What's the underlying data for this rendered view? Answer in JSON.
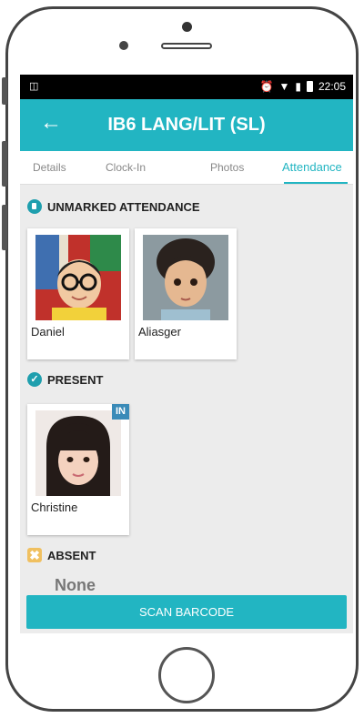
{
  "status_bar": {
    "left_icon": "lock-screen-icon",
    "time": "22:05",
    "icons": [
      "alarm-icon",
      "wifi-icon",
      "signal-icon",
      "battery-icon"
    ]
  },
  "appbar": {
    "back_icon": "arrow-left-icon",
    "title": "IB6 LANG/LIT (SL)"
  },
  "tabs": [
    {
      "label": "Details",
      "active": false
    },
    {
      "label": "Clock-In",
      "active": false
    },
    {
      "label": "Photos",
      "active": false
    },
    {
      "label": "Attendance",
      "active": true
    }
  ],
  "sections": {
    "unmarked": {
      "title": "UNMARKED ATTENDANCE",
      "icon": "unmarked-icon",
      "students": [
        {
          "name": "Daniel"
        },
        {
          "name": "Aliasger"
        }
      ]
    },
    "present": {
      "title": "PRESENT",
      "icon": "check-circle-icon",
      "students": [
        {
          "name": "Christine",
          "badge": "IN"
        }
      ]
    },
    "absent": {
      "title": "ABSENT",
      "icon": "absent-x-icon",
      "empty_text": "None"
    }
  },
  "scan_button": {
    "label": "SCAN BARCODE"
  },
  "colors": {
    "accent": "#22b5c2",
    "badge": "#3a8bb8",
    "absent": "#f0c060"
  }
}
